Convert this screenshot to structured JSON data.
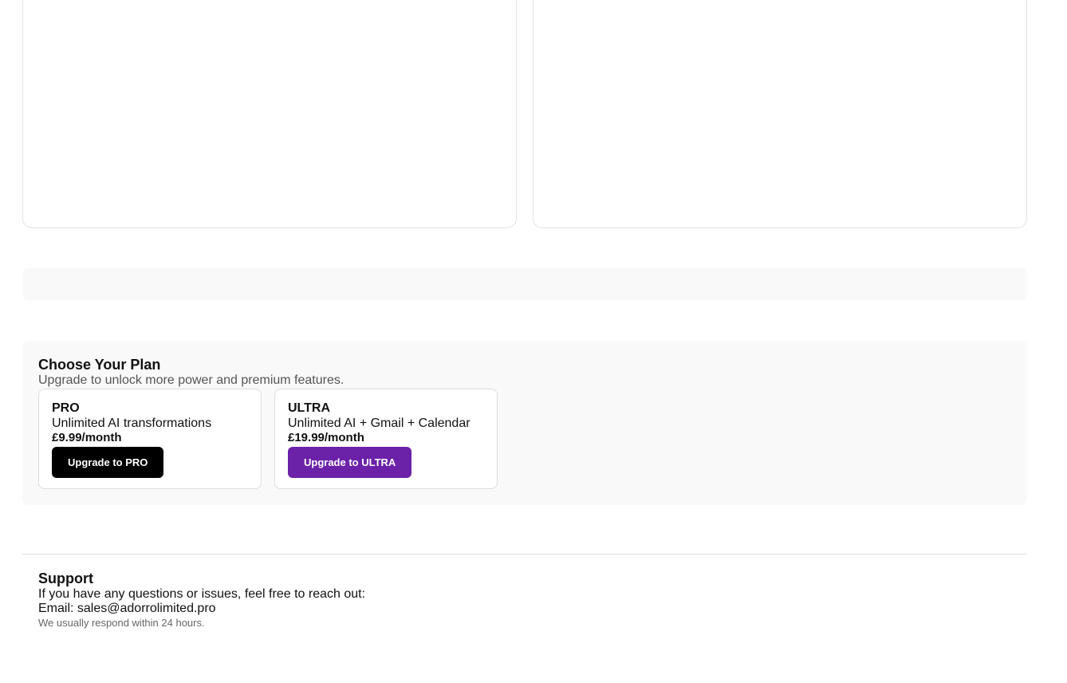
{
  "plans_section": {
    "title": "Choose Your Plan",
    "subtitle": "Upgrade to unlock more power and premium features.",
    "plans": [
      {
        "name": "PRO",
        "description": "Unlimited AI transformations",
        "price": "£9.99/month",
        "button_label": "Upgrade to PRO",
        "button_color": "#000000"
      },
      {
        "name": "ULTRA",
        "description": "Unlimited AI + Gmail + Calendar",
        "price": "£19.99/month",
        "button_label": "Upgrade to ULTRA",
        "button_color": "#6b21a8"
      }
    ]
  },
  "support": {
    "title": "Support",
    "text": "If you have any questions or issues, feel free to reach out:",
    "email_line": "Email: sales@adorrolimited.pro",
    "note": "We usually respond within 24 hours."
  }
}
